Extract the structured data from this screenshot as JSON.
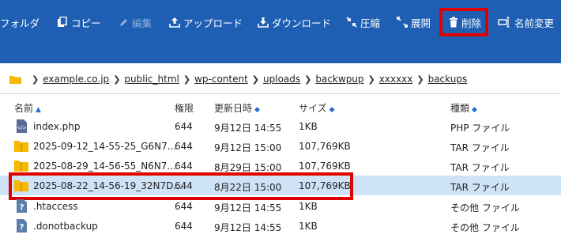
{
  "toolbar": {
    "items": [
      {
        "label": "フォルダ",
        "icon": "folder-icon",
        "disabled": false
      },
      {
        "label": "コピー",
        "icon": "copy-icon",
        "disabled": false
      },
      {
        "label": "編集",
        "icon": "pencil-icon",
        "disabled": true
      },
      {
        "label": "アップロード",
        "icon": "upload-icon",
        "disabled": false
      },
      {
        "label": "ダウンロード",
        "icon": "download-icon",
        "disabled": false
      },
      {
        "label": "圧縮",
        "icon": "compress-icon",
        "disabled": false
      },
      {
        "label": "展開",
        "icon": "expand-icon",
        "disabled": false
      },
      {
        "label": "削除",
        "icon": "trash-icon",
        "disabled": false
      },
      {
        "label": "名前変更",
        "icon": "rename-icon",
        "disabled": false
      }
    ]
  },
  "breadcrumb": {
    "items": [
      "example.co.jp",
      "public_html",
      "wp-content",
      "uploads",
      "backwpup",
      "xxxxxx",
      "backups"
    ]
  },
  "table": {
    "columns": {
      "name": "名前",
      "perm": "権限",
      "date": "更新日時",
      "size": "サイズ",
      "type": "種類"
    },
    "rows": [
      {
        "name": "index.php",
        "perm": "644",
        "date": "9月12日 14:55",
        "size": "1KB",
        "type": "PHP ファイル",
        "icon": "php-file-icon",
        "selected": false
      },
      {
        "name": "2025-09-12_14-55-25_G6N7...",
        "perm": "644",
        "date": "9月12日 15:00",
        "size": "107,769KB",
        "type": "TAR ファイル",
        "icon": "archive-folder-icon",
        "selected": false
      },
      {
        "name": "2025-08-29_14-56-55_N6N7...",
        "perm": "644",
        "date": "8月29日 15:00",
        "size": "107,769KB",
        "type": "TAR ファイル",
        "icon": "archive-folder-icon",
        "selected": false
      },
      {
        "name": "2025-08-22_14-56-19_32N7D...",
        "perm": "644",
        "date": "8月22日 15:00",
        "size": "107,769KB",
        "type": "TAR ファイル",
        "icon": "archive-folder-icon",
        "selected": true
      },
      {
        "name": ".htaccess",
        "perm": "644",
        "date": "9月12日 14:55",
        "size": "1KB",
        "type": "その他 ファイル",
        "icon": "unknown-file-icon",
        "selected": false
      },
      {
        "name": ".donotbackup",
        "perm": "644",
        "date": "9月12日 14:55",
        "size": "1KB",
        "type": "その他 ファイル",
        "icon": "unknown-file-icon",
        "selected": false
      }
    ]
  },
  "colors": {
    "toolbar": "#1e5fb4",
    "highlight": "#e00000",
    "selected_row": "#cfe3f7",
    "folder": "#f5b800"
  }
}
